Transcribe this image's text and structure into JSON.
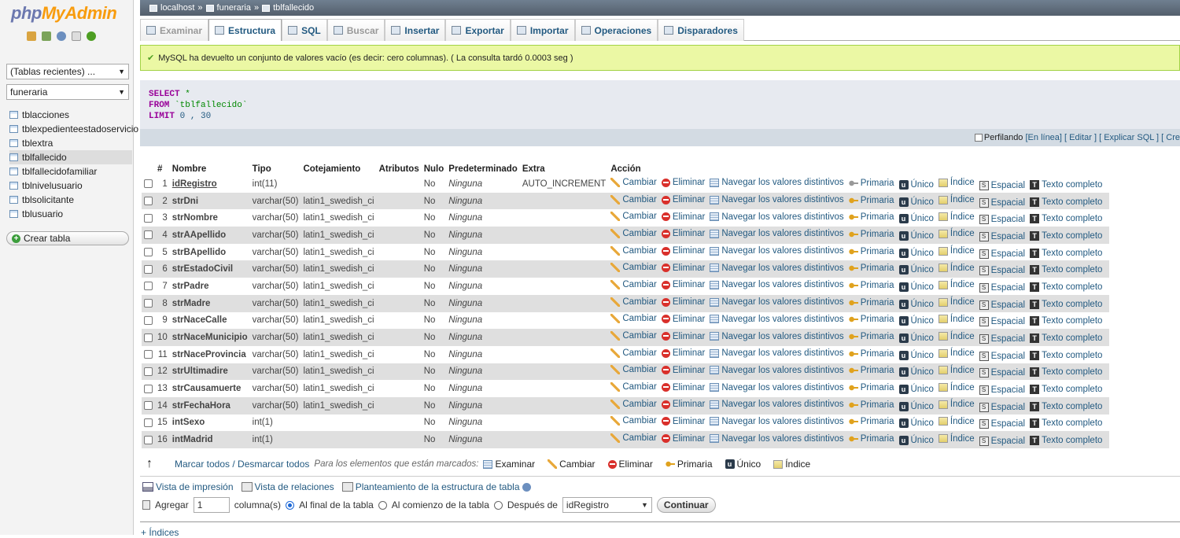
{
  "logo": {
    "php": "php",
    "myadmin": "MyAdmin"
  },
  "sidebar": {
    "recent_select": "(Tablas recientes) ...",
    "db_select": "funeraria",
    "tables": [
      "tblacciones",
      "tblexpedienteestadoservicio",
      "tblextra",
      "tblfallecido",
      "tblfallecidofamiliar",
      "tblnivelusuario",
      "tblsolicitante",
      "tblusuario"
    ],
    "selected_table": "tblfallecido",
    "create_table": "Crear tabla"
  },
  "breadcrumb": {
    "server": "localhost",
    "sep": "»",
    "database": "funeraria",
    "table": "tblfallecido"
  },
  "tabs": [
    {
      "label": "Examinar",
      "state": "disabled"
    },
    {
      "label": "Estructura",
      "state": "active"
    },
    {
      "label": "SQL",
      "state": "normal"
    },
    {
      "label": "Buscar",
      "state": "disabled"
    },
    {
      "label": "Insertar",
      "state": "normal"
    },
    {
      "label": "Exportar",
      "state": "normal"
    },
    {
      "label": "Importar",
      "state": "normal"
    },
    {
      "label": "Operaciones",
      "state": "normal"
    },
    {
      "label": "Disparadores",
      "state": "normal"
    }
  ],
  "message": "MySQL ha devuelto un conjunto de valores vacío (es decir: cero columnas). ( La consulta tardó 0.0003 seg )",
  "sql": {
    "select": "SELECT",
    "star": "*",
    "from": "FROM",
    "table": "`tblfallecido`",
    "limit": "LIMIT",
    "limit_vals": "0 , 30"
  },
  "sqlbar": {
    "profiling": "Perfilando",
    "inline": "[En línea]",
    "edit": "[ Editar ]",
    "explain": "[ Explicar SQL ]",
    "create": "[ Cre"
  },
  "table": {
    "headers": [
      "#",
      "Nombre",
      "Tipo",
      "Cotejamiento",
      "Atributos",
      "Nulo",
      "Predeterminado",
      "Extra",
      "Acción"
    ],
    "rows": [
      {
        "n": "1",
        "name": "idRegistro",
        "type": "int(11)",
        "coll": "",
        "attr": "",
        "null": "No",
        "def": "Ninguna",
        "extra": "AUTO_INCREMENT"
      },
      {
        "n": "2",
        "name": "strDni",
        "type": "varchar(50)",
        "coll": "latin1_swedish_ci",
        "attr": "",
        "null": "No",
        "def": "Ninguna",
        "extra": ""
      },
      {
        "n": "3",
        "name": "strNombre",
        "type": "varchar(50)",
        "coll": "latin1_swedish_ci",
        "attr": "",
        "null": "No",
        "def": "Ninguna",
        "extra": ""
      },
      {
        "n": "4",
        "name": "strAApellido",
        "type": "varchar(50)",
        "coll": "latin1_swedish_ci",
        "attr": "",
        "null": "No",
        "def": "Ninguna",
        "extra": ""
      },
      {
        "n": "5",
        "name": "strBApellido",
        "type": "varchar(50)",
        "coll": "latin1_swedish_ci",
        "attr": "",
        "null": "No",
        "def": "Ninguna",
        "extra": ""
      },
      {
        "n": "6",
        "name": "strEstadoCivil",
        "type": "varchar(50)",
        "coll": "latin1_swedish_ci",
        "attr": "",
        "null": "No",
        "def": "Ninguna",
        "extra": ""
      },
      {
        "n": "7",
        "name": "strPadre",
        "type": "varchar(50)",
        "coll": "latin1_swedish_ci",
        "attr": "",
        "null": "No",
        "def": "Ninguna",
        "extra": ""
      },
      {
        "n": "8",
        "name": "strMadre",
        "type": "varchar(50)",
        "coll": "latin1_swedish_ci",
        "attr": "",
        "null": "No",
        "def": "Ninguna",
        "extra": ""
      },
      {
        "n": "9",
        "name": "strNaceCalle",
        "type": "varchar(50)",
        "coll": "latin1_swedish_ci",
        "attr": "",
        "null": "No",
        "def": "Ninguna",
        "extra": ""
      },
      {
        "n": "10",
        "name": "strNaceMunicipio",
        "type": "varchar(50)",
        "coll": "latin1_swedish_ci",
        "attr": "",
        "null": "No",
        "def": "Ninguna",
        "extra": ""
      },
      {
        "n": "11",
        "name": "strNaceProvincia",
        "type": "varchar(50)",
        "coll": "latin1_swedish_ci",
        "attr": "",
        "null": "No",
        "def": "Ninguna",
        "extra": ""
      },
      {
        "n": "12",
        "name": "strUltimadire",
        "type": "varchar(50)",
        "coll": "latin1_swedish_ci",
        "attr": "",
        "null": "No",
        "def": "Ninguna",
        "extra": ""
      },
      {
        "n": "13",
        "name": "strCausamuerte",
        "type": "varchar(50)",
        "coll": "latin1_swedish_ci",
        "attr": "",
        "null": "No",
        "def": "Ninguna",
        "extra": ""
      },
      {
        "n": "14",
        "name": "strFechaHora",
        "type": "varchar(50)",
        "coll": "latin1_swedish_ci",
        "attr": "",
        "null": "No",
        "def": "Ninguna",
        "extra": ""
      },
      {
        "n": "15",
        "name": "intSexo",
        "type": "int(1)",
        "coll": "",
        "attr": "",
        "null": "No",
        "def": "Ninguna",
        "extra": ""
      },
      {
        "n": "16",
        "name": "intMadrid",
        "type": "int(1)",
        "coll": "",
        "attr": "",
        "null": "No",
        "def": "Ninguna",
        "extra": ""
      }
    ],
    "actions": {
      "change": "Cambiar",
      "drop": "Eliminar",
      "browse": "Navegar los valores distintivos",
      "primary": "Primaria",
      "unique": "Único",
      "index": "Índice",
      "spatial": "Espacial",
      "fulltext": "Texto completo"
    }
  },
  "bulk": {
    "check_all": "Marcar todos / Desmarcar todos",
    "with_selected": "Para los elementos que están marcados:",
    "browse": "Examinar",
    "change": "Cambiar",
    "drop": "Eliminar",
    "primary": "Primaria",
    "unique": "Único",
    "index": "Índice"
  },
  "links": {
    "print": "Vista de impresión",
    "relations": "Vista de relaciones",
    "propose": "Planteamiento de la estructura de tabla"
  },
  "addcol": {
    "add": "Agregar",
    "count": "1",
    "columns": "columna(s)",
    "at_end": "Al final de la tabla",
    "at_begin": "Al comienzo de la tabla",
    "after": "Después de",
    "after_field": "idRegistro",
    "go": "Continuar"
  },
  "indexes_link": "+ Índices"
}
